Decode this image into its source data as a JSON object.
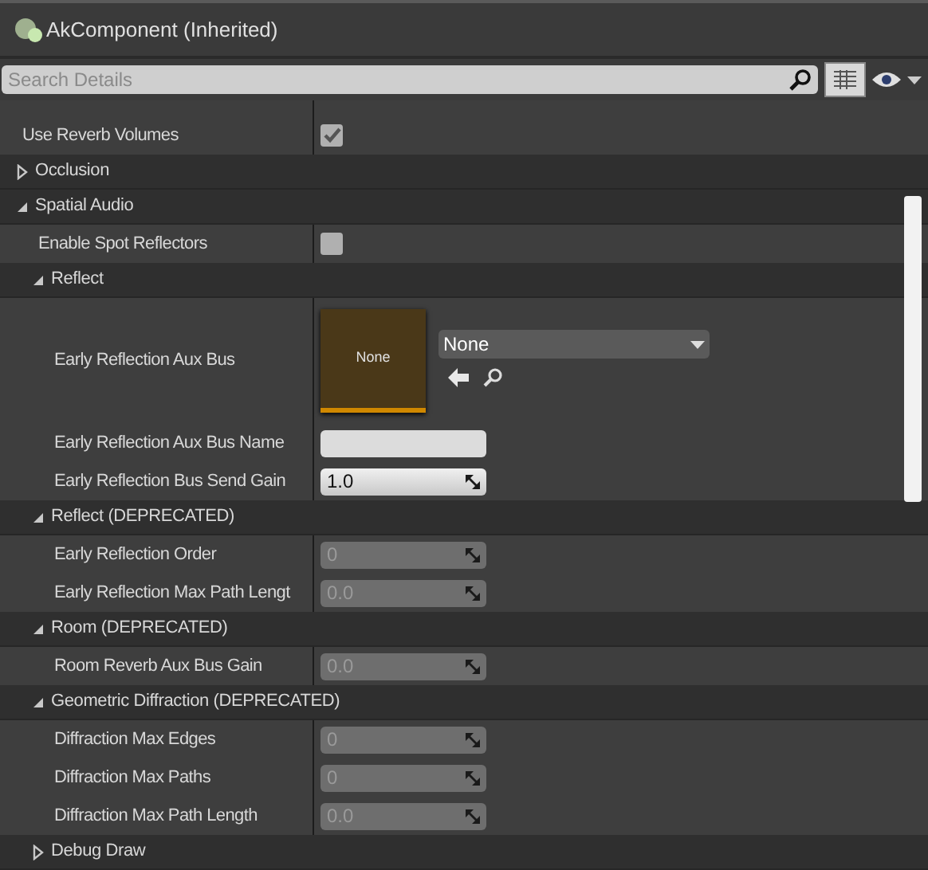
{
  "header": {
    "title": "AkComponent (Inherited)"
  },
  "search": {
    "placeholder": "Search Details"
  },
  "rows": [
    {
      "kind": "property",
      "label": "Use Reverb Volumes",
      "value": {
        "kind": "checkbox",
        "checked": true
      }
    },
    {
      "kind": "category",
      "label": "Occlusion",
      "expanded": false
    },
    {
      "kind": "category",
      "label": "Spatial Audio",
      "expanded": true,
      "children": [
        {
          "kind": "property",
          "label": "Enable Spot Reflectors",
          "value": {
            "kind": "checkbox",
            "checked": false
          }
        },
        {
          "kind": "category",
          "label": "Reflect",
          "expanded": true,
          "children": [
            {
              "kind": "property",
              "label": "Early Reflection Aux Bus",
              "value": {
                "kind": "asset",
                "thumbnail_label": "None",
                "selection": "None"
              }
            },
            {
              "kind": "property",
              "label": "Early Reflection Aux Bus Name",
              "value": {
                "kind": "text"
              }
            },
            {
              "kind": "property",
              "label": "Early Reflection Bus Send Gain",
              "value": {
                "kind": "number",
                "text": "1.0",
                "disabled": false
              }
            }
          ]
        },
        {
          "kind": "category",
          "label": "Reflect (DEPRECATED)",
          "expanded": true,
          "children": [
            {
              "kind": "property",
              "label": "Early Reflection Order",
              "value": {
                "kind": "number",
                "text": "0",
                "disabled": true
              }
            },
            {
              "kind": "property",
              "label": "Early Reflection Max Path Lengt",
              "value": {
                "kind": "number",
                "text": "0.0",
                "disabled": true
              }
            }
          ]
        },
        {
          "kind": "category",
          "label": "Room (DEPRECATED)",
          "expanded": true,
          "children": [
            {
              "kind": "property",
              "label": "Room Reverb Aux Bus Gain",
              "value": {
                "kind": "number",
                "text": "0.0",
                "disabled": true
              }
            }
          ]
        },
        {
          "kind": "category",
          "label": "Geometric Diffraction (DEPRECATED)",
          "expanded": true,
          "children": [
            {
              "kind": "property",
              "label": "Diffraction Max Edges",
              "value": {
                "kind": "number",
                "text": "0",
                "disabled": true
              }
            },
            {
              "kind": "property",
              "label": "Diffraction Max Paths",
              "value": {
                "kind": "number",
                "text": "0",
                "disabled": true
              }
            },
            {
              "kind": "property",
              "label": "Diffraction Max Path Length",
              "value": {
                "kind": "number",
                "text": "0.0",
                "disabled": true
              }
            }
          ]
        },
        {
          "kind": "category",
          "label": "Debug Draw",
          "expanded": false
        }
      ]
    }
  ]
}
